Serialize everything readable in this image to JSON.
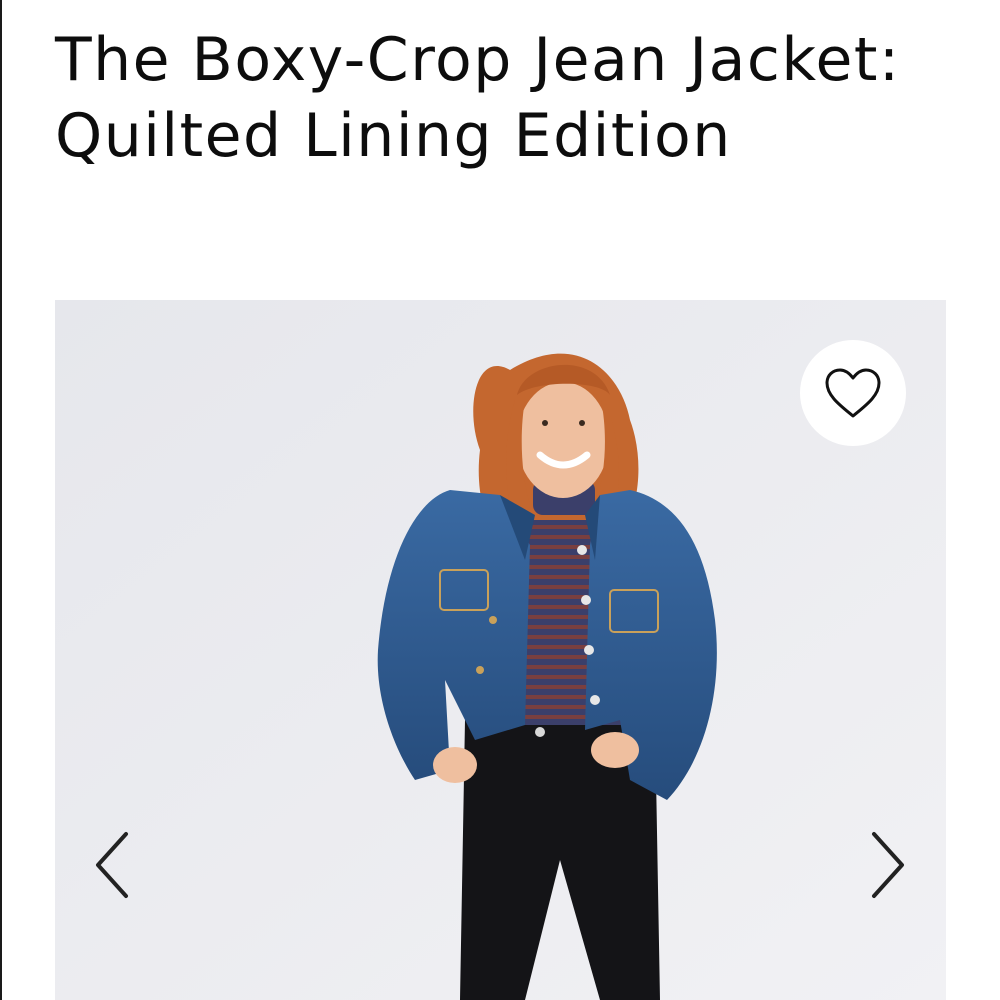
{
  "product": {
    "title": "The Boxy-Crop Jean Jacket: Quilted Lining Edition"
  },
  "gallery": {
    "image_alt": "Model wearing denim jacket",
    "favorite_icon": "heart-outline-icon",
    "prev_icon": "chevron-left-icon",
    "next_icon": "chevron-right-icon"
  },
  "colors": {
    "text": "#0d0d0d",
    "image_background": "#eaebef",
    "denim": "#2f5a8f",
    "hair": "#c4672f",
    "jeans": "#141417"
  }
}
